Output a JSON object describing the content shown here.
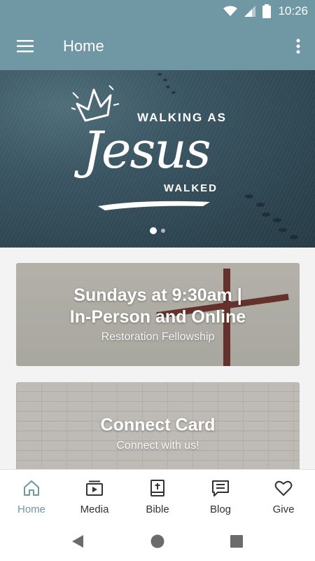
{
  "status_bar": {
    "time": "10:26"
  },
  "app_bar": {
    "title": "Home",
    "menu_icon": "hamburger-menu-icon",
    "overflow_icon": "more-vert-icon"
  },
  "hero": {
    "line1": "WALKING AS",
    "line2": "Jesus",
    "line3": "WALKED",
    "slide_count": 2,
    "active_slide": 1
  },
  "cards": [
    {
      "title_line1": "Sundays at 9:30am |",
      "title_line2": "In-Person and Online",
      "subtitle": "Restoration Fellowship"
    },
    {
      "title": "Connect Card",
      "subtitle": "Connect with us!"
    }
  ],
  "bottom_nav": [
    {
      "label": "Home",
      "icon": "home-icon",
      "active": true
    },
    {
      "label": "Media",
      "icon": "media-icon",
      "active": false
    },
    {
      "label": "Bible",
      "icon": "bible-icon",
      "active": false
    },
    {
      "label": "Blog",
      "icon": "blog-icon",
      "active": false
    },
    {
      "label": "Give",
      "icon": "heart-icon",
      "active": false
    }
  ],
  "colors": {
    "primary": "#6f97a4",
    "card_text": "#ffffff",
    "nav_inactive": "#333333"
  }
}
